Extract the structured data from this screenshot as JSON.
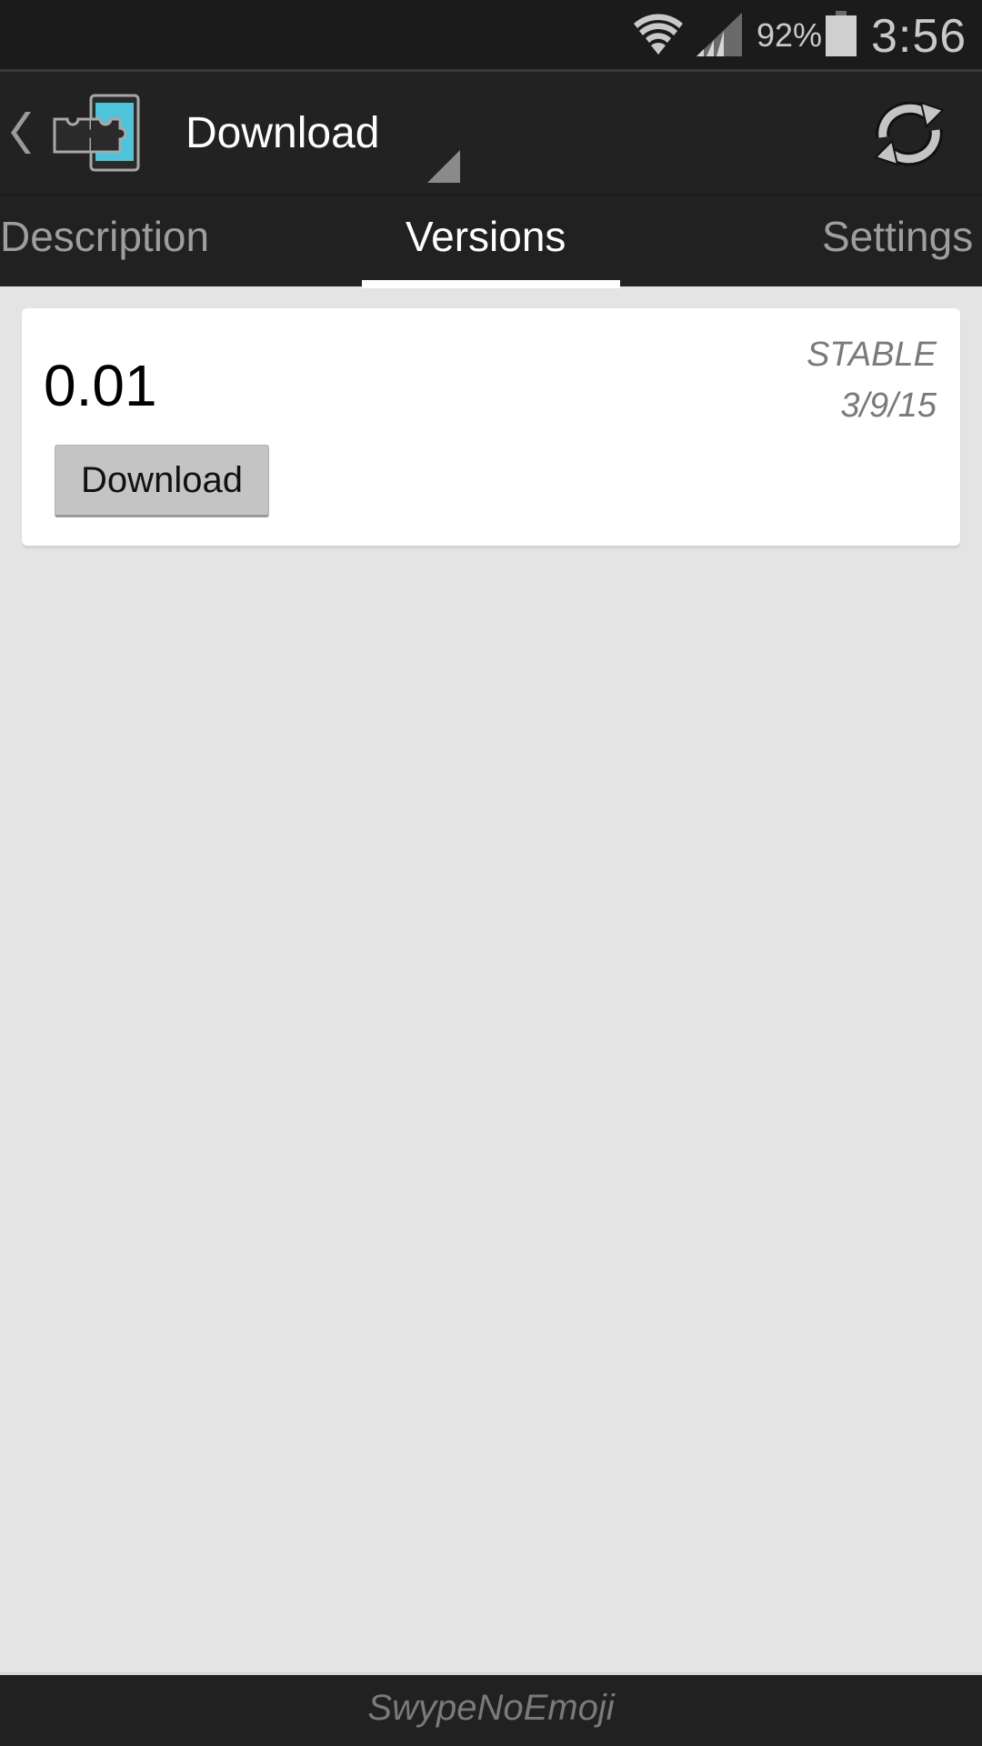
{
  "status_bar": {
    "wifi_icon": "wifi-icon",
    "signal_icon": "cell-signal-icon",
    "battery_percent": "92%",
    "battery_icon": "battery-icon",
    "time": "3:56"
  },
  "action_bar": {
    "back_icon": "chevron-left-icon",
    "app_icon": "xposed-puzzle-phone-icon",
    "title": "Download",
    "refresh_icon": "refresh-icon",
    "colors": {
      "accent": "#4fc3d9",
      "background": "#222222"
    }
  },
  "tabs": [
    {
      "label": "Description",
      "active": false
    },
    {
      "label": "Versions",
      "active": true
    },
    {
      "label": "Settings",
      "active": false
    }
  ],
  "versions": [
    {
      "version": "0.01",
      "channel": "STABLE",
      "date": "3/9/15",
      "button_label": "Download"
    }
  ],
  "bottom_bar": {
    "text": "SwypeNoEmoji"
  }
}
